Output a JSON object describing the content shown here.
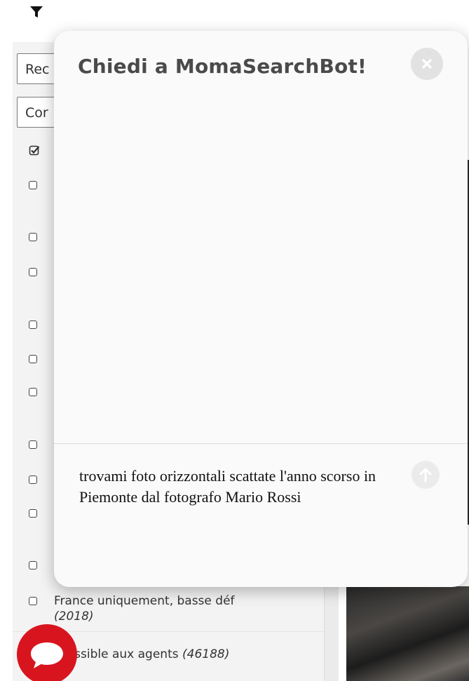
{
  "background": {
    "filters": {
      "select_1_text": "Rec",
      "select_2_text": "Cor",
      "rows": [
        {
          "label": "France uniquement, basse déf",
          "count": "(2018)"
        },
        {
          "label": "ccessible aux agents",
          "count": "(46188)"
        }
      ]
    },
    "icons": {
      "filter": "filter-icon",
      "chat": "chat-bubble-icon"
    },
    "colors": {
      "fab": "#d8151f"
    }
  },
  "chat_modal": {
    "title": "Chiedi a MomaSearchBot!",
    "prompt_text": "trovami foto orizzontali scattate l'anno scorso in Piemonte dal fotografo Mario Rossi",
    "icons": {
      "close": "close-icon",
      "send": "arrow-up-icon"
    }
  }
}
